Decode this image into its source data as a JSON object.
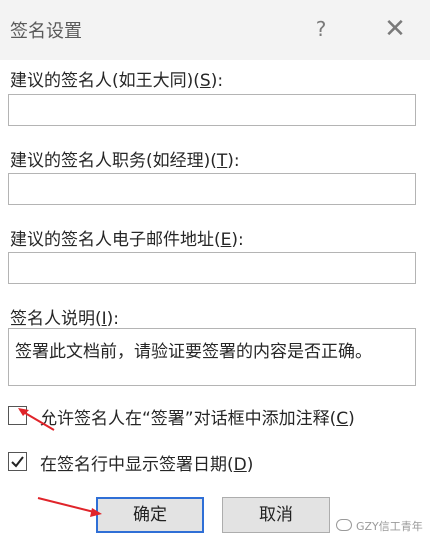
{
  "dialog": {
    "title": "签名设置",
    "help_glyph": "?",
    "close_glyph": "✕"
  },
  "fields": [
    {
      "label_pre": "建议的签名人(如王大同)(",
      "mnemonic": "S",
      "label_post": "):",
      "value": ""
    },
    {
      "label_pre": "建议的签名人职务(如经理)(",
      "mnemonic": "T",
      "label_post": "):",
      "value": ""
    },
    {
      "label_pre": "建议的签名人电子邮件地址(",
      "mnemonic": "E",
      "label_post": "):",
      "value": ""
    }
  ],
  "instructions": {
    "label_pre": "签名人说明(",
    "mnemonic": "I",
    "label_post": "):",
    "value": "签署此文档前，请验证要签署的内容是否正确。"
  },
  "options": [
    {
      "label_pre": "允许签名人在“签署”对话框中添加注释(",
      "mnemonic": "C",
      "label_post": ")",
      "checked": false
    },
    {
      "label_pre": "在签名行中显示签署日期(",
      "mnemonic": "D",
      "label_post": ")",
      "checked": true
    }
  ],
  "buttons": {
    "ok": "确定",
    "cancel": "取消"
  },
  "watermark": {
    "text": "GZY信工青年"
  },
  "colors": {
    "arrow": "#e0242a",
    "default_button_border": "#2f6fd6",
    "button_face": "#e3e3e3"
  },
  "icons": [
    "help-icon",
    "close-icon",
    "checkmark-icon",
    "arrow-annotation"
  ]
}
